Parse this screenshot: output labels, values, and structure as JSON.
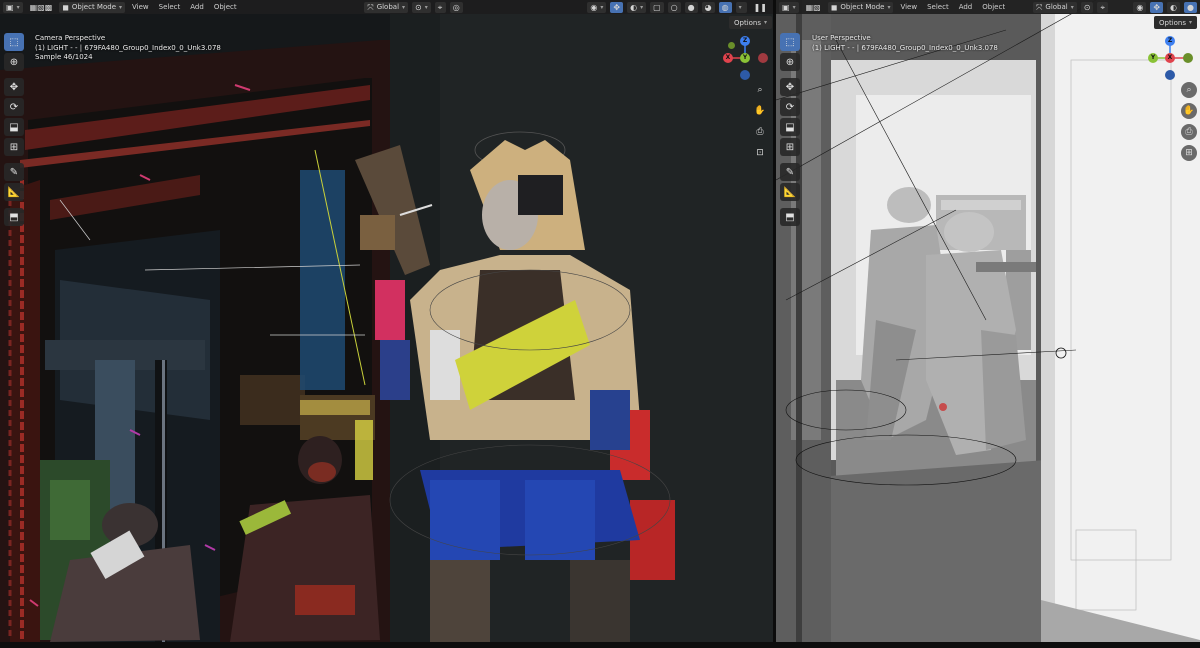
{
  "left_viewport": {
    "header": {
      "mode_label": "Object Mode",
      "menus": [
        "View",
        "Select",
        "Add",
        "Object"
      ],
      "transform_orientation": "Global"
    },
    "options_label": "Options",
    "overlay_lines": [
      "Camera Perspective",
      "(1) LIGHT - - | 679FA480_Group0_Index0_0_Unk3.078",
      "Sample 46/1024"
    ]
  },
  "right_viewport": {
    "header": {
      "mode_label": "Object Mode",
      "menus": [
        "View",
        "Select",
        "Add",
        "Object"
      ],
      "transform_orientation": "Global"
    },
    "options_label": "Options",
    "overlay_lines": [
      "User Perspective",
      "(1) LIGHT - - | 679FA480_Group0_Index0_0_Unk3.078"
    ]
  },
  "gizmo_axes": {
    "x": "X",
    "y": "Y",
    "z": "Z"
  },
  "colors": {
    "axis_x": "#e0434d",
    "axis_y": "#8ac236",
    "axis_z": "#3d7ff0",
    "active_tool": "#4772b3"
  },
  "icons": {
    "toolbar": [
      "select-box-icon",
      "cursor-icon",
      "move-icon",
      "rotate-icon",
      "scale-icon",
      "transform-icon",
      "annotate-icon",
      "measure-icon",
      "add-cube-icon"
    ],
    "nav": [
      "zoom-icon",
      "hand-pan-icon",
      "camera-icon",
      "lock-icon"
    ]
  }
}
